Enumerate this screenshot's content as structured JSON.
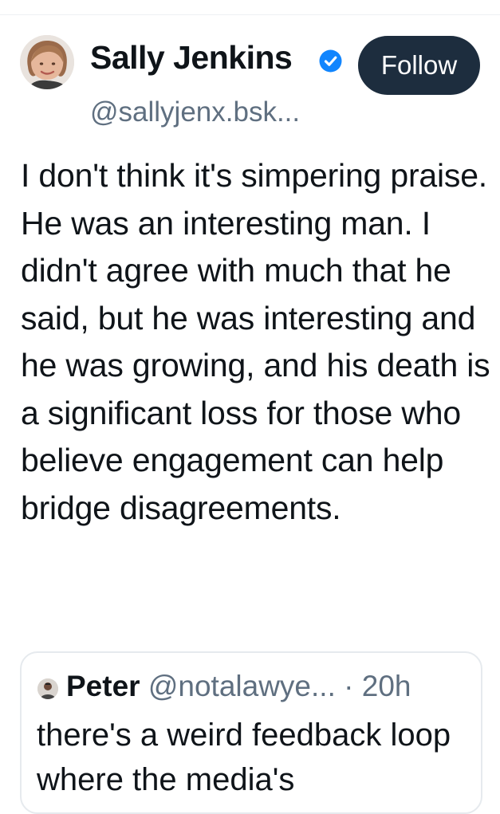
{
  "post": {
    "author": {
      "display_name": "Sally Jenkins",
      "handle": "@sallyjenx.bsk...",
      "verified_icon": "verified-badge-icon",
      "avatar_icon": "profile-photo"
    },
    "follow_label": "Follow",
    "text": "I don't think it's simpering praise. He was an interesting man. I didn't agree with much that he said, but he was interesting and he was growing, and his death is a significant loss for those who believe engagement can help bridge disagreements.",
    "quote": {
      "name": "Peter",
      "handle": "@notalawye...",
      "separator": "·",
      "time": "20h",
      "text": "there's a weird feedback loop where the media's"
    }
  },
  "colors": {
    "follow_button_bg": "#1d2d3e",
    "verified_blue": "#1185fe",
    "secondary_text": "#5f6f80"
  }
}
